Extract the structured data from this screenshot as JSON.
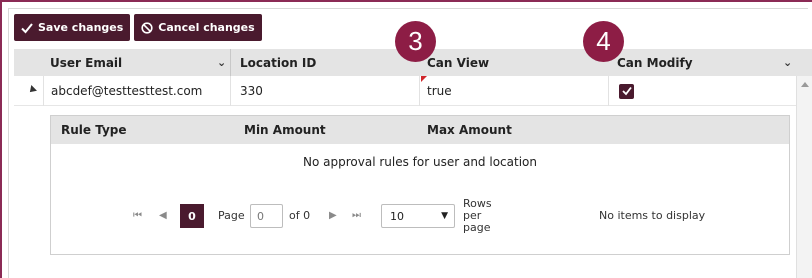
{
  "toolbar": {
    "save_label": "Save changes",
    "cancel_label": "Cancel changes"
  },
  "grid": {
    "columns": [
      "User Email",
      "Location ID",
      "Can View",
      "Can Modify"
    ],
    "rows": [
      {
        "email": "abcdef@testtesttest.com",
        "location_id": "330",
        "can_view": "true",
        "can_modify": true
      }
    ]
  },
  "detail": {
    "columns": [
      "Rule Type",
      "Min Amount",
      "Max Amount"
    ],
    "empty_message": "No approval rules for user and location",
    "pager": {
      "current_page": "0",
      "page_label": "Page",
      "page_input_placeholder": "0",
      "of_label": "of 0",
      "rows_per_page": "10",
      "rows_label_1": "Rows",
      "rows_label_2": "per",
      "rows_label_3": "page",
      "status": "No items to display"
    }
  },
  "annotations": {
    "badge_3": "3",
    "badge_4": "4"
  },
  "colors": {
    "accent": "#4a1a2e",
    "badge": "#8d1d45",
    "frame": "#8b2a55"
  }
}
